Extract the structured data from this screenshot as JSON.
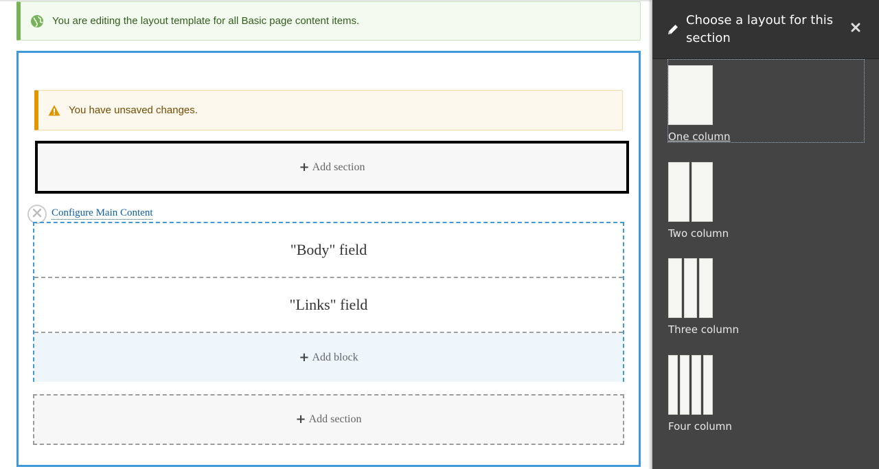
{
  "status_message": "You are editing the layout template for all Basic page content items.",
  "warning_message": "You have unsaved changes.",
  "add_section_label": "Add section",
  "configure_link": "Configure Main Content",
  "blocks": [
    {
      "label": "\"Body\" field"
    },
    {
      "label": "\"Links\" field"
    }
  ],
  "add_block_label": "Add block",
  "plus_glyph": "+",
  "panel": {
    "title": "Choose a layout for this section",
    "close_glyph": "✕",
    "layouts": [
      {
        "label": "One column",
        "columns": 1,
        "active": true
      },
      {
        "label": "Two column",
        "columns": 2,
        "active": false
      },
      {
        "label": "Three column",
        "columns": 3,
        "active": false
      },
      {
        "label": "Four column",
        "columns": 4,
        "active": false
      }
    ]
  },
  "colors": {
    "status_accent": "#77b259",
    "warning_accent": "#e09600",
    "frame_accent": "#3f98d8",
    "panel_background": "#444444",
    "link": "#0d5ea8"
  },
  "icons": {
    "status": "globe-icon",
    "warning": "warning-triangle-icon",
    "remove": "close-circle-icon",
    "edit": "pencil-icon",
    "close": "close-icon"
  }
}
